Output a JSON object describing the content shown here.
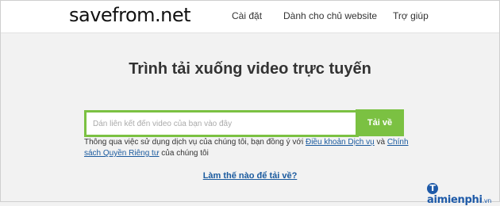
{
  "header": {
    "logo": "savefrom.net",
    "nav": [
      "Cài đặt",
      "Dành cho chủ website",
      "Trợ giúp"
    ]
  },
  "main": {
    "title": "Trình tải xuống video trực tuyến",
    "search": {
      "placeholder": "Dán liên kết đến video của bạn vào đây",
      "value": ""
    },
    "submit_label": "Tải về",
    "terms": {
      "prefix": "Thông qua việc sử dụng dịch vụ của chúng tôi, bạn đồng ý với ",
      "link1": "Điều khoản Dịch vụ",
      "and": " và ",
      "link2": "Chính sách Quyền Riêng tư",
      "suffix": " của chúng tôi"
    },
    "howto_link": "Làm thế nào để tải về?"
  },
  "watermark": {
    "brand": "aimienphi",
    "initial": "T",
    "tld": ".vn"
  }
}
